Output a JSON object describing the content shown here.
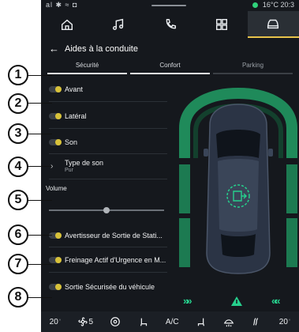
{
  "status": {
    "left": "al ✱ ≈ ◘",
    "temp": "16°C",
    "time": "20:3"
  },
  "nav": {
    "tabs": [
      "home",
      "music",
      "phone",
      "apps",
      "car"
    ]
  },
  "header": {
    "back": "←",
    "title": "Aides à la conduite"
  },
  "subtabs": [
    "Sécurité",
    "Confort",
    "Parking"
  ],
  "items": [
    {
      "label": "Avant",
      "type": "toggle"
    },
    {
      "label": "Latéral",
      "type": "toggle"
    },
    {
      "label": "Son",
      "type": "toggle"
    },
    {
      "label": "Type de son",
      "sub": "Pur",
      "type": "link"
    },
    {
      "label": "Avertisseur de Sortie de Stati...",
      "type": "toggle"
    },
    {
      "label": "Freinage Actif d'Urgence en M...",
      "type": "toggle"
    },
    {
      "label": "Sortie Sécurisée du véhicule",
      "type": "toggle"
    }
  ],
  "volume": {
    "label": "Volume",
    "level": 0.5
  },
  "callouts": [
    "1",
    "2",
    "3",
    "4",
    "5",
    "6",
    "7",
    "8"
  ],
  "bottom": {
    "temp_left": "20",
    "temp_left_unit": "°",
    "fan": "5",
    "ac": "A/C",
    "temp_right": "20",
    "temp_right_unit": "°"
  },
  "colors": {
    "accent": "#26d08d",
    "toggle_on": "#d8c23a",
    "background": "#15181d"
  }
}
